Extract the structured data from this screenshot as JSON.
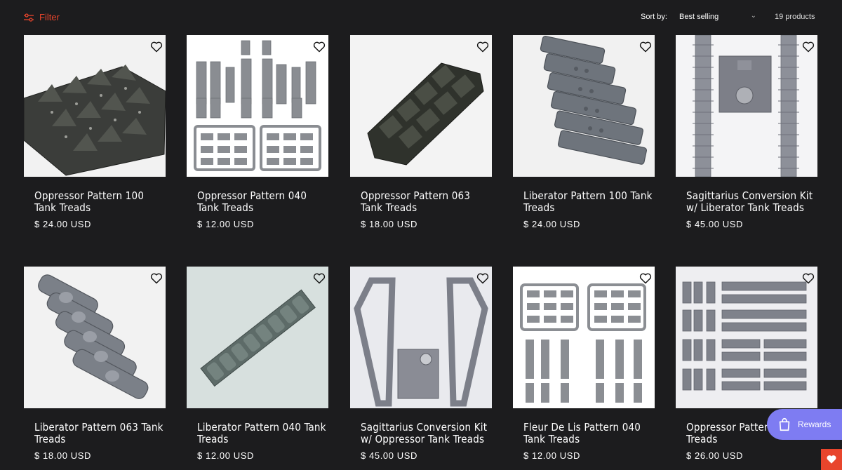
{
  "toolbar": {
    "filter_label": "Filter",
    "sort_label": "Sort by:",
    "sort_value": "Best selling",
    "product_count": "19 products"
  },
  "products": [
    {
      "title": "Oppressor Pattern 100 Tank Treads",
      "price": "$ 24.00 USD"
    },
    {
      "title": "Oppressor Pattern 040 Tank Treads",
      "price": "$ 12.00 USD"
    },
    {
      "title": "Oppressor Pattern 063 Tank Treads",
      "price": "$ 18.00 USD"
    },
    {
      "title": "Liberator Pattern 100 Tank Treads",
      "price": "$ 24.00 USD"
    },
    {
      "title": "Sagittarius Conversion Kit w/ Liberator Tank Treads",
      "price": "$ 45.00 USD"
    },
    {
      "title": "Liberator Pattern 063 Tank Treads",
      "price": "$ 18.00 USD"
    },
    {
      "title": "Liberator Pattern 040 Tank Treads",
      "price": "$ 12.00 USD"
    },
    {
      "title": "Sagittarius Conversion Kit w/ Oppressor Tank Treads",
      "price": "$ 45.00 USD"
    },
    {
      "title": "Fleur De Lis Pattern 040 Tank Treads",
      "price": "$ 12.00 USD"
    },
    {
      "title": "Oppressor Pattern C Treads",
      "price": "$ 26.00 USD"
    }
  ],
  "rewards": {
    "label": "Rewards"
  },
  "colors": {
    "accent": "#e8452c",
    "background": "#1c1c1e",
    "rewards": "#7e7cf2"
  },
  "icons": {
    "filter": "sliders-icon",
    "wishlist": "heart-icon",
    "sort": "chevron-down-icon",
    "rewards": "shopping-bag-icon"
  }
}
